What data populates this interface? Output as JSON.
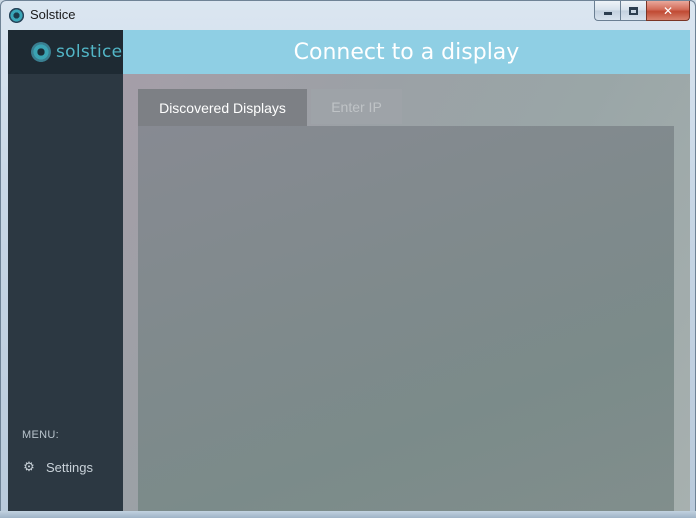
{
  "window": {
    "title": "Solstice",
    "icon": "solstice-logo-icon",
    "controls": [
      "minimize",
      "maximize",
      "close"
    ]
  },
  "sidebar": {
    "brand": "solstice",
    "menu_label": "MENU:",
    "items": [
      {
        "label": "Settings",
        "icon": "gear-icon"
      }
    ]
  },
  "header": {
    "title": "Connect to a display"
  },
  "tabs": [
    {
      "label": "Discovered Displays",
      "active": true
    },
    {
      "label": "Enter IP",
      "active": false
    }
  ],
  "colors": {
    "header_bg": "#8fcfe4",
    "sidebar_bg": "#2c3842",
    "brand_bg": "#1e2a33",
    "brand_accent": "#52b6c7",
    "active_tab_bg": "#7d8085",
    "inactive_tab_bg": "#9ea3a8"
  }
}
